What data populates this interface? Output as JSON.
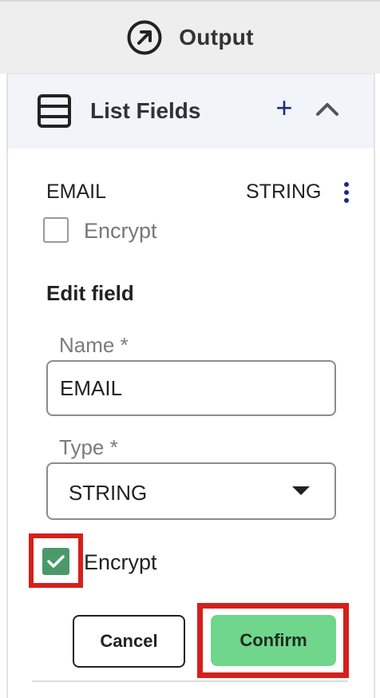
{
  "output": {
    "title": "Output",
    "icon": "arrow-up-right-circle-icon"
  },
  "list_fields": {
    "title": "List Fields",
    "icon": "list-icon",
    "add_label": "+",
    "collapse_icon": "chevron-up-icon"
  },
  "field": {
    "name": "EMAIL",
    "type": "STRING",
    "menu_icon": "kebab-icon",
    "encrypt_label": "Encrypt",
    "encrypted": false
  },
  "edit": {
    "title": "Edit field",
    "name_label": "Name *",
    "name_value": "EMAIL",
    "type_label": "Type *",
    "type_value": "STRING",
    "encrypt_label": "Encrypt",
    "encrypt_checked": true,
    "cancel_label": "Cancel",
    "confirm_label": "Confirm"
  },
  "colors": {
    "accent_blue": "#1c2a83",
    "check_green": "#4a9a69",
    "confirm_green": "#6fd68c",
    "highlight_red": "#d4201c"
  }
}
